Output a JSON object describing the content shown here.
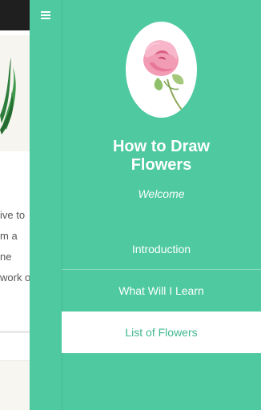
{
  "background_page": {
    "text_lines": [
      "ive to",
      "m a",
      "ne",
      "work of"
    ]
  },
  "drawer": {
    "menu_icon": "hamburger-menu-icon",
    "logo_icon": "rose-icon",
    "title_line1": "How to Draw",
    "title_line2": "Flowers",
    "welcome": "Welcome",
    "menu_items": [
      {
        "label": "Introduction",
        "active": false
      },
      {
        "label": "What Will I Learn",
        "active": false
      },
      {
        "label": "List of Flowers",
        "active": true
      }
    ]
  },
  "colors": {
    "drawer_bg": "#4ec9a0",
    "active_item_bg": "#ffffff",
    "active_item_text": "#3fb88e",
    "topbar": "#1f1f1f"
  }
}
